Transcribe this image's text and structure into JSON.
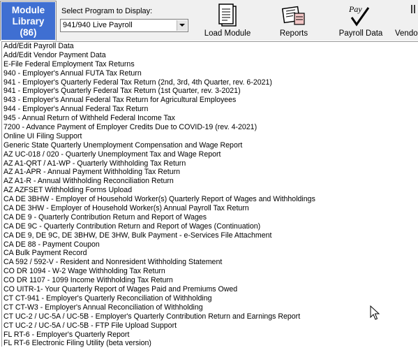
{
  "toolbar": {
    "module_library": {
      "line1": "Module",
      "line2": "Library",
      "count": "(86)"
    },
    "select_label": "Select Program to Display:",
    "program_select": {
      "value": "941/940 Live Payroll"
    },
    "buttons": [
      {
        "label": "Load Module",
        "icon": "document-icon"
      },
      {
        "label": "Reports",
        "icon": "report-icon"
      },
      {
        "label": "Payroll Data",
        "icon": "pay-check-icon",
        "icon_text": "Pay"
      },
      {
        "label": "Vendo",
        "icon": "vendor-icon"
      }
    ]
  },
  "program_list": [
    "Add/Edit Payroll Data",
    "Add/Edit Vendor Payment Data",
    "E-File Federal Employment Tax Returns",
    "940 - Employer's Annual FUTA Tax Return",
    "941 - Employer's Quarterly Federal Tax Return (2nd, 3rd, 4th Quarter, rev. 6-2021)",
    "941 - Employer's Quarterly Federal Tax Return (1st Quarter, rev. 3-2021)",
    "943 - Employer's Annual Federal Tax Return for Agricultural Employees",
    "944 - Employer's Annual Federal Tax Return",
    "945 - Annual Return of Withheld Federal Income Tax",
    "7200 - Advance Payment of Employer Credits Due to COVID-19 (rev. 4-2021)",
    "Online UI Filing Support",
    "Generic State Quarterly Unemployment Compensation and Wage Report",
    "AZ UC-018 / 020 - Quarterly Unemployment Tax and Wage Report",
    "AZ A1-QRT / A1-WP - Quarterly Withholding Tax Return",
    "AZ A1-APR - Annual Payment Withholding Tax Return",
    "AZ A1-R - Annual Withholding Reconciliation Return",
    "AZ AZFSET Withholding Forms Upload",
    "CA DE 3BHW - Employer of Household Worker(s) Quarterly Report of Wages and Withholdings",
    "CA DE 3HW - Employer of Household Worker(s) Annual Payroll Tax Return",
    "CA DE 9 - Quarterly Contribution Return and Report of Wages",
    "CA DE 9C - Quarterly Contribution Return and Report of Wages (Continuation)",
    "CA DE 9, DE 9C, DE 3BHW, DE 3HW, Bulk Payment - e-Services File Attachment",
    "CA DE 88 - Payment Coupon",
    "CA Bulk Payment Record",
    "CA 592 / 592-V - Resident and Nonresident Withholding Statement",
    "CO DR 1094 - W-2 Wage Withholding Tax Return",
    "CO DR 1107 - 1099 Income Withholding Tax Return",
    "CO UITR-1- Your Quarterly Report of Wages Paid and Premiums Owed",
    "CT CT-941 - Employer's Quarterly Reconciliation of Withholding",
    "CT CT-W3 - Employer's Annual Reconciliation of Withholding",
    "CT UC-2 / UC-5A / UC-5B - Employer's Quarterly Contribution Return and Earnings Report",
    "CT UC-2 / UC-5A / UC-5B - FTP File Upload Support",
    "FL RT-6 - Employer's Quarterly Report",
    "FL RT-6 Electronic Filing Utility (beta version)"
  ]
}
